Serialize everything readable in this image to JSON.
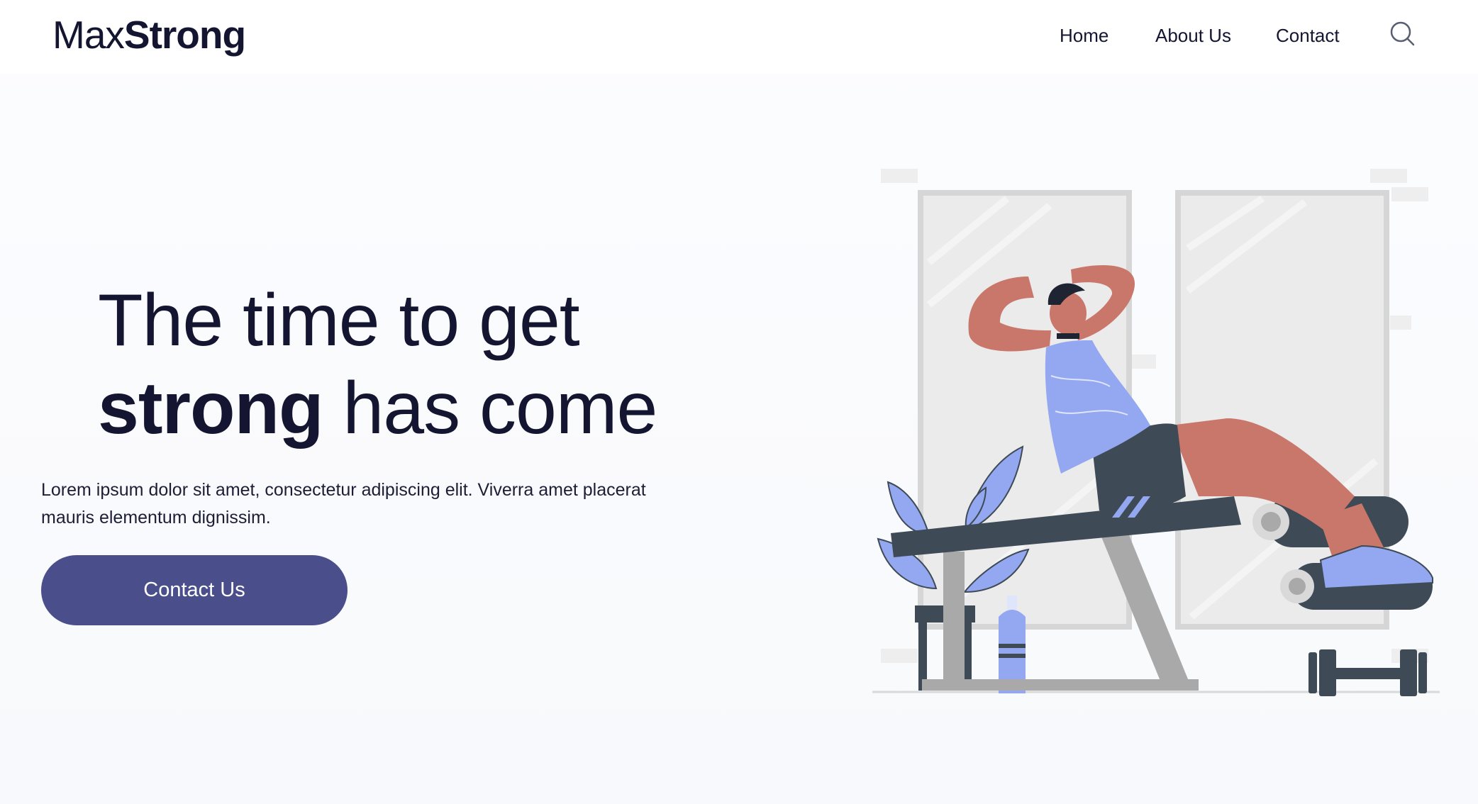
{
  "brand": {
    "logo_light": "Max",
    "logo_bold": "Strong"
  },
  "nav": {
    "items": [
      {
        "label": "Home"
      },
      {
        "label": "About Us"
      },
      {
        "label": "Contact"
      }
    ],
    "search_icon": "search-icon"
  },
  "hero": {
    "headline_line1": "The time to get",
    "headline_bold": "strong",
    "headline_rest": " has come",
    "body": "Lorem ipsum dolor sit amet, consectetur adipiscing elit. Viverra amet placerat mauris elementum dignissim.",
    "cta_label": "Contact Us"
  },
  "colors": {
    "text": "#141631",
    "cta": "#4a4f8c",
    "accent_blue": "#93a8f0",
    "skin": "#c9776a",
    "dark": "#3e4a55"
  }
}
